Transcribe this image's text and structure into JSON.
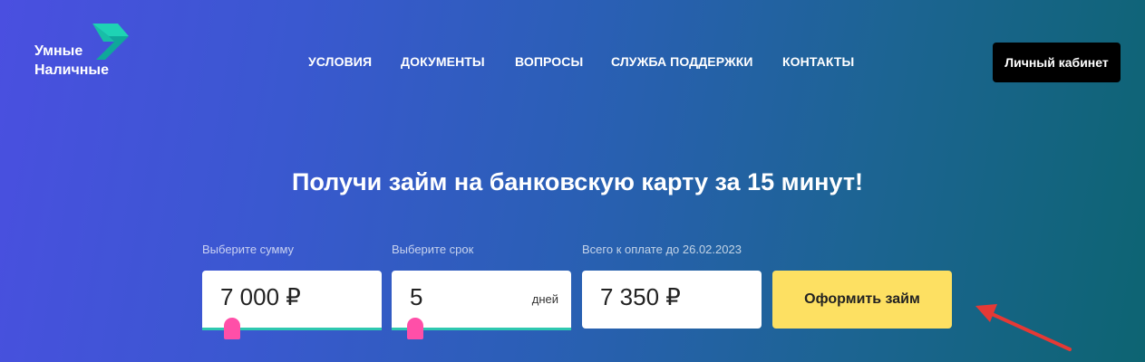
{
  "brand": {
    "line1": "Умные",
    "line2": "Наличные"
  },
  "nav": {
    "items": [
      {
        "label": "УСЛОВИЯ"
      },
      {
        "label": "ДОКУМЕНТЫ"
      },
      {
        "label": "ВОПРОСЫ"
      },
      {
        "label": "СЛУЖБА ПОДДЕРЖКИ"
      },
      {
        "label": "КОНТАКТЫ"
      }
    ],
    "cabinet_label": "Личный кабинет"
  },
  "hero": {
    "title": "Получи займ на банковскую карту за 15 минут!"
  },
  "calculator": {
    "amount": {
      "label": "Выберите сумму",
      "value": "7 000 ₽",
      "slider_fraction": 0.05
    },
    "term": {
      "label": "Выберите срок",
      "value": "5",
      "unit": "дней",
      "slider_fraction": 0.0
    },
    "total": {
      "label": "Всего к оплате до 26.02.2023",
      "value": "7 350 ₽"
    },
    "submit_label": "Оформить займ"
  },
  "colors": {
    "accent_yellow": "#fde062",
    "slider_handle": "#ff4fa8",
    "slider_track": "#2ec8b0",
    "annotation_arrow": "#e53935"
  }
}
